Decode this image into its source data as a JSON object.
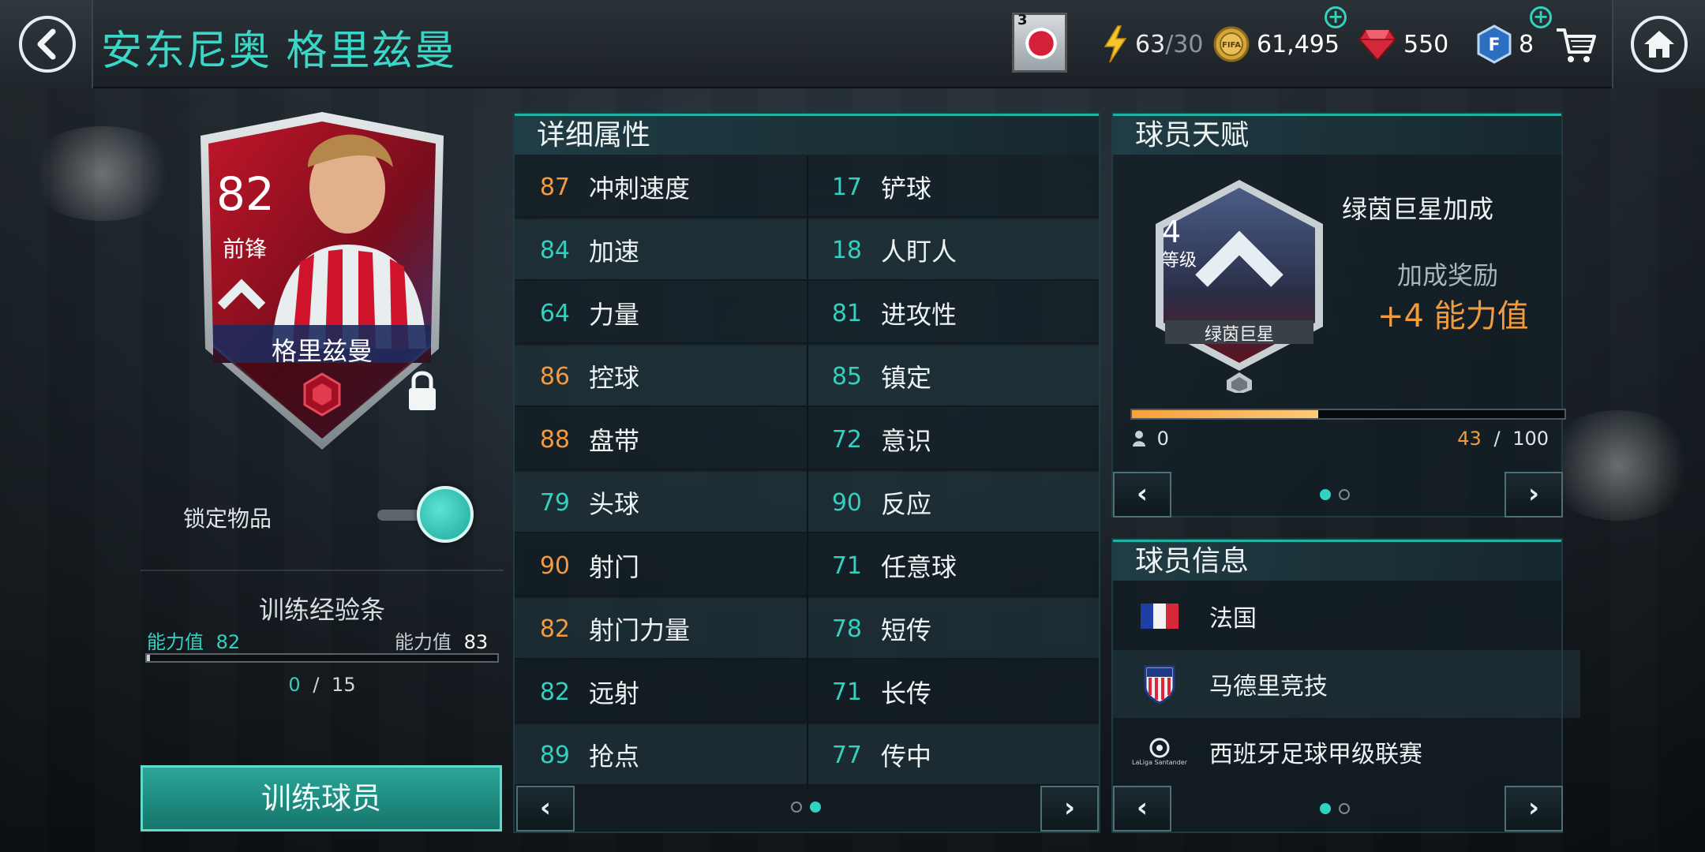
{
  "header": {
    "title": "安东尼奥 格里兹曼",
    "club_badge_number": "3",
    "energy": {
      "current": "63",
      "max": "/30"
    },
    "coins": "61,495",
    "gems": "550",
    "fifa_points": "8"
  },
  "card": {
    "rating": "82",
    "position": "前锋",
    "name": "格里兹曼"
  },
  "lock": {
    "label": "锁定物品",
    "toggle_on": true
  },
  "training": {
    "title": "训练经验条",
    "current_label": "能力值",
    "current_value": "82",
    "next_label": "能力值",
    "next_value": "83",
    "xp_current": "0",
    "xp_separator": "/",
    "xp_max": "15",
    "xp_fraction": 0.01,
    "button": "训练球员"
  },
  "attributes": {
    "title": "详细属性",
    "left": [
      {
        "value": "87",
        "name": "冲刺速度",
        "tone": "orange"
      },
      {
        "value": "84",
        "name": "加速",
        "tone": "teal"
      },
      {
        "value": "64",
        "name": "力量",
        "tone": "teal"
      },
      {
        "value": "86",
        "name": "控球",
        "tone": "orange"
      },
      {
        "value": "88",
        "name": "盘带",
        "tone": "orange"
      },
      {
        "value": "79",
        "name": "头球",
        "tone": "teal"
      },
      {
        "value": "90",
        "name": "射门",
        "tone": "orange"
      },
      {
        "value": "82",
        "name": "射门力量",
        "tone": "orange"
      },
      {
        "value": "82",
        "name": "远射",
        "tone": "teal"
      },
      {
        "value": "89",
        "name": "抢点",
        "tone": "teal"
      }
    ],
    "right": [
      {
        "value": "17",
        "name": "铲球",
        "tone": "teal"
      },
      {
        "value": "18",
        "name": "人盯人",
        "tone": "teal"
      },
      {
        "value": "81",
        "name": "进攻性",
        "tone": "teal"
      },
      {
        "value": "85",
        "name": "镇定",
        "tone": "teal"
      },
      {
        "value": "72",
        "name": "意识",
        "tone": "teal"
      },
      {
        "value": "90",
        "name": "反应",
        "tone": "teal"
      },
      {
        "value": "71",
        "name": "任意球",
        "tone": "teal"
      },
      {
        "value": "78",
        "name": "短传",
        "tone": "teal"
      },
      {
        "value": "71",
        "name": "长传",
        "tone": "teal"
      },
      {
        "value": "77",
        "name": "传中",
        "tone": "teal"
      }
    ],
    "prev": "‹",
    "next": "›"
  },
  "talent": {
    "title": "球员天赋",
    "level": "4",
    "level_label": "等级",
    "badge_name": "绿茵巨星",
    "talent_name": "绿茵巨星加成",
    "bonus_label": "加成奖励",
    "bonus_value": "+4 能力值",
    "progress_min": "0",
    "progress_current": "43",
    "progress_separator": "/",
    "progress_max": "100",
    "progress_fraction": 0.43,
    "prev": "‹",
    "next": "›"
  },
  "info": {
    "title": "球员信息",
    "nation": "法国",
    "club": "马德里竞技",
    "league": "西班牙足球甲级联赛",
    "league_logo_text": "LaLiga Santander",
    "prev": "‹",
    "next": "›"
  },
  "colors": {
    "accent": "#34cfc0",
    "orange": "#f29b3e",
    "title": "#3ad6c8"
  }
}
